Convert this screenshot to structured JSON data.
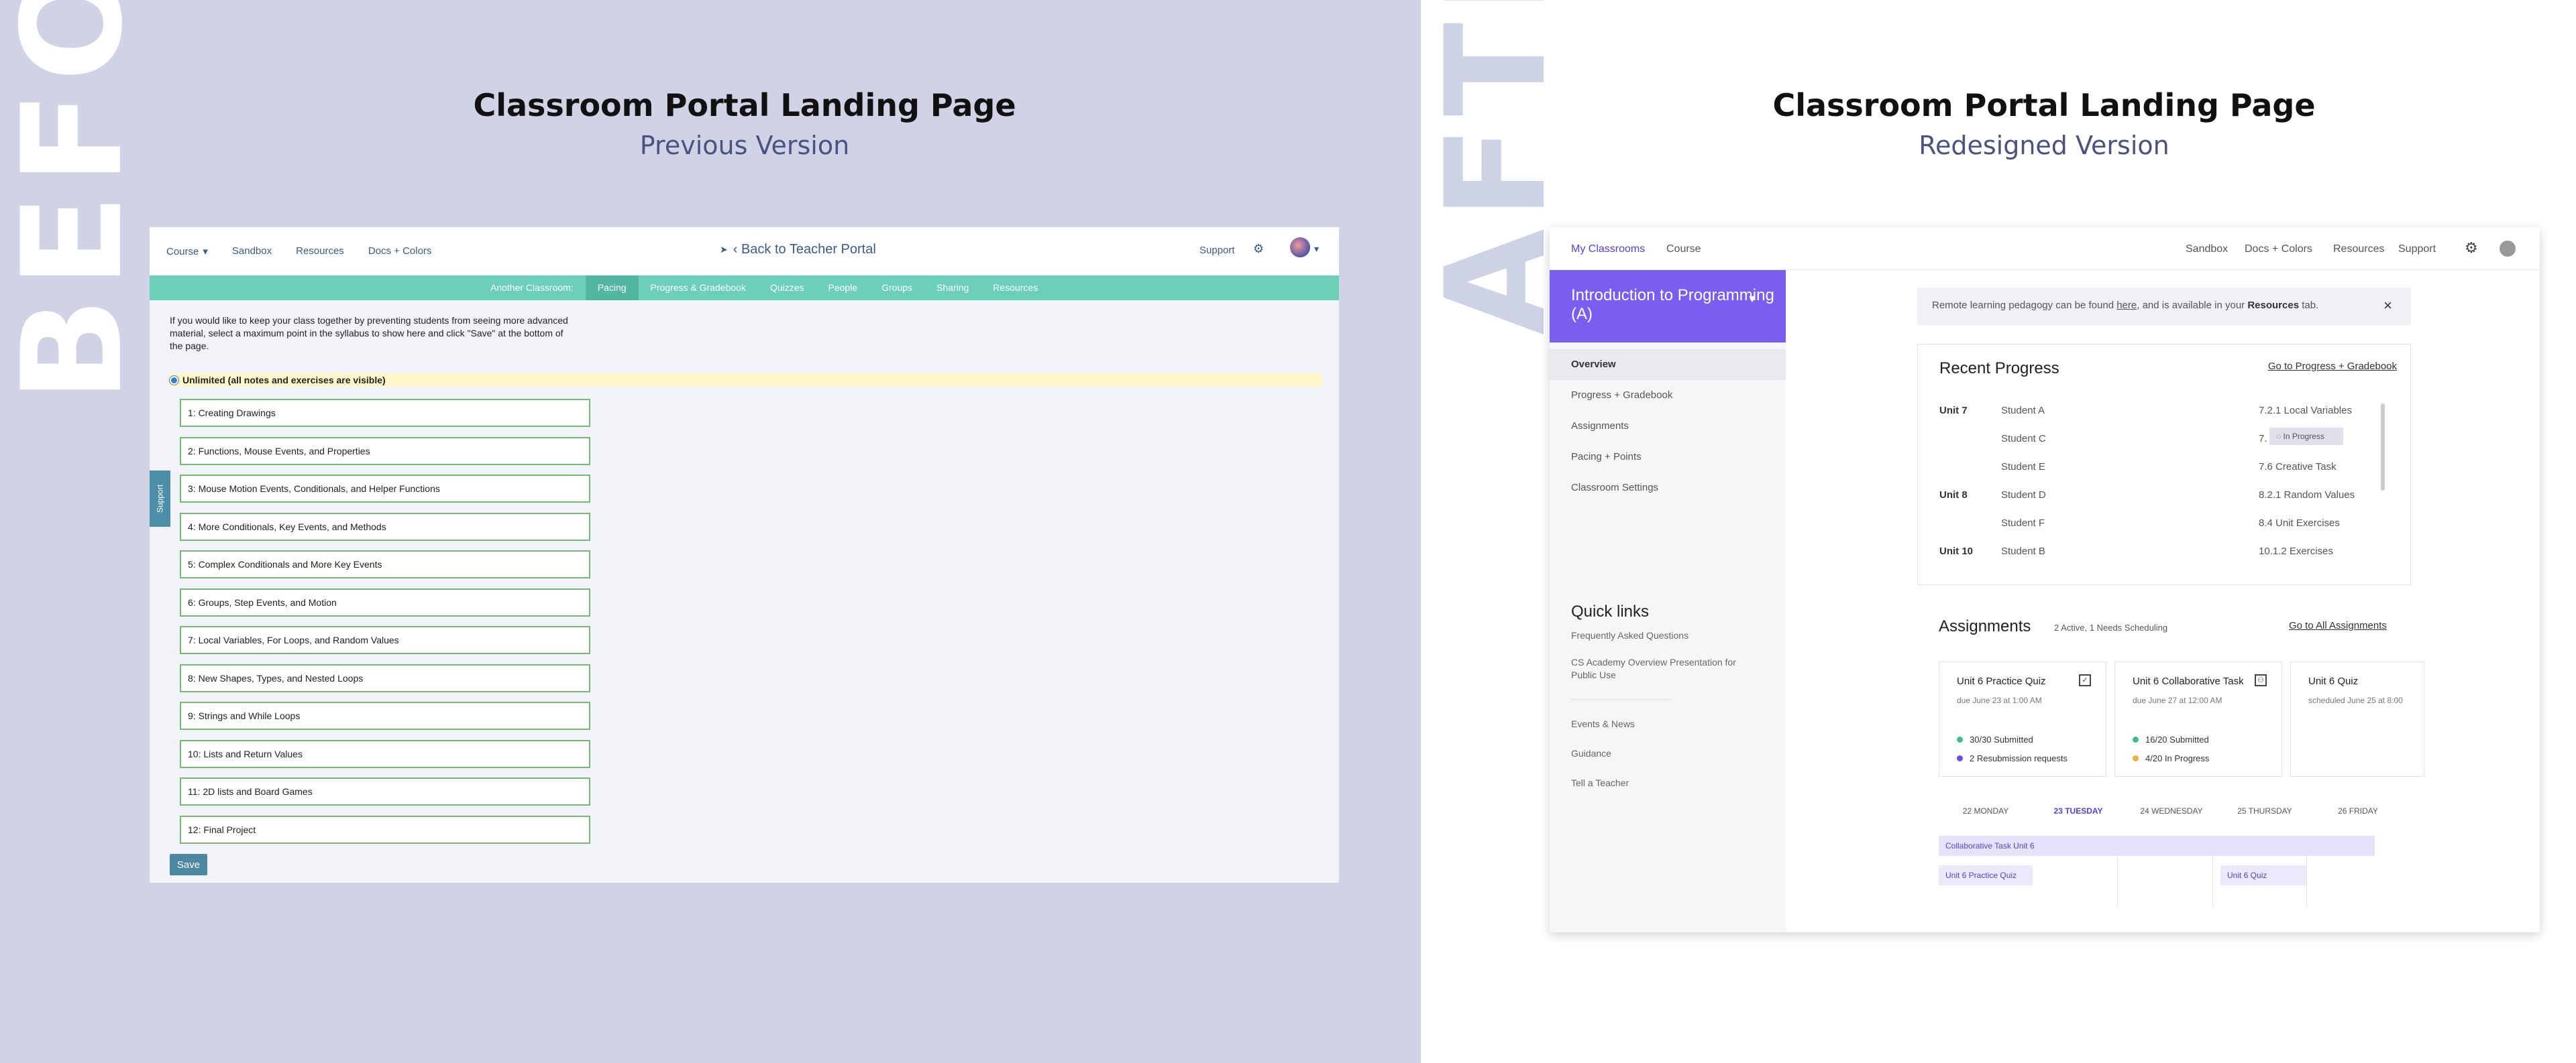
{
  "labels": {
    "before": "BEFORE",
    "after": "AFTER"
  },
  "header": {
    "title_before": "Classroom Portal Landing Page",
    "subtitle_before": "Previous Version",
    "title_after": "Classroom Portal Landing Page",
    "subtitle_after": "Redesigned Version"
  },
  "before": {
    "nav": {
      "course": "Course",
      "sandbox": "Sandbox",
      "resources": "Resources",
      "docs": "Docs + Colors"
    },
    "back": "‹ Back to Teacher Portal",
    "support": "Support",
    "tabs": [
      "Another Classroom:",
      "Pacing",
      "Progress & Gradebook",
      "Quizzes",
      "People",
      "Groups",
      "Sharing",
      "Resources"
    ],
    "active_tab": "Pacing",
    "intro": "If you would like to keep your class together by preventing students from seeing more advanced material, select a maximum point in the syllabus to show here and click \"Save\" at the bottom of the page.",
    "unlimited": "Unlimited (all notes and exercises are visible)",
    "units": [
      "1: Creating Drawings",
      "2: Functions, Mouse Events, and Properties",
      "3: Mouse Motion Events, Conditionals, and Helper Functions",
      "4: More Conditionals, Key Events, and Methods",
      "5: Complex Conditionals and More Key Events",
      "6: Groups, Step Events, and Motion",
      "7: Local Variables, For Loops, and Random Values",
      "8: New Shapes, Types, and Nested Loops",
      "9: Strings and While Loops",
      "10: Lists and Return Values",
      "11: 2D lists and Board Games",
      "12: Final Project"
    ],
    "save": "Save",
    "support_tab": "Support"
  },
  "after": {
    "nav": {
      "my_classrooms": "My Classrooms",
      "course": "Course",
      "sandbox": "Sandbox",
      "docs": "Docs + Colors",
      "resources": "Resources",
      "support": "Support"
    },
    "course_name": "Introduction to Programming (A)",
    "menu": [
      "Overview",
      "Progress + Gradebook",
      "Assignments",
      "Pacing + Points",
      "Classroom Settings"
    ],
    "quick_links_title": "Quick links",
    "quick_links": [
      "Frequently Asked Questions",
      "CS Academy Overview Presentation for Public Use"
    ],
    "more_links": [
      "Events & News",
      "Guidance",
      "Tell a Teacher"
    ],
    "banner": {
      "pre": "Remote learning pedagogy can be found ",
      "here": "here",
      "mid": ", and is available in your ",
      "resources": "Resources",
      "post": " tab."
    },
    "recent_progress": {
      "title": "Recent Progress",
      "link": "Go to Progress + Gradebook",
      "rows": [
        {
          "unit": "Unit 7",
          "student": "Student A",
          "lesson": "7.2.1 Local Variables"
        },
        {
          "unit": "",
          "student": "Student C",
          "lesson": "7."
        },
        {
          "unit": "",
          "student": "Student E",
          "lesson": "7.6 Creative Task"
        },
        {
          "unit": "Unit 8",
          "student": "Student D",
          "lesson": "8.2.1 Random Values"
        },
        {
          "unit": "",
          "student": "Student F",
          "lesson": "8.4 Unit Exercises"
        },
        {
          "unit": "Unit 10",
          "student": "Student B",
          "lesson": "10.1.2 Exercises"
        }
      ],
      "tooltip": "In Progress"
    },
    "assignments": {
      "title": "Assignments",
      "summary": "2 Active, 1 Needs Scheduling",
      "link": "Go to All Assignments",
      "cards": [
        {
          "name": "Unit 6 Practice Quiz",
          "due": "due June 23 at 1:00 AM",
          "stat1": "30/30 Submitted",
          "stat2": "2 Resubmission requests"
        },
        {
          "name": "Unit 6 Collaborative Task",
          "due": "due June 27 at 12:00 AM",
          "stat1": "16/20 Submitted",
          "stat2": "4/20 In Progress"
        },
        {
          "name": "Unit 6 Quiz",
          "due": "scheduled June 25 at 8:00",
          "stat1": "",
          "stat2": ""
        }
      ],
      "colors": {
        "submitted": "#3dbf8a",
        "resubmission": "#6c4fe0",
        "in_progress": "#f0b03c"
      }
    },
    "calendar": {
      "days": [
        "22 MONDAY",
        "23 TUESDAY",
        "24 WEDNESDAY",
        "25 THURSDAY",
        "26 FRIDAY"
      ],
      "events": [
        "Collaborative Task Unit 6",
        "Unit 6 Practice Quiz",
        "Unit 6 Quiz"
      ]
    }
  },
  "colors": {
    "before_bg": "#d0d3e6",
    "teal": "#6bcfba",
    "purple": "#7a5ef0"
  }
}
